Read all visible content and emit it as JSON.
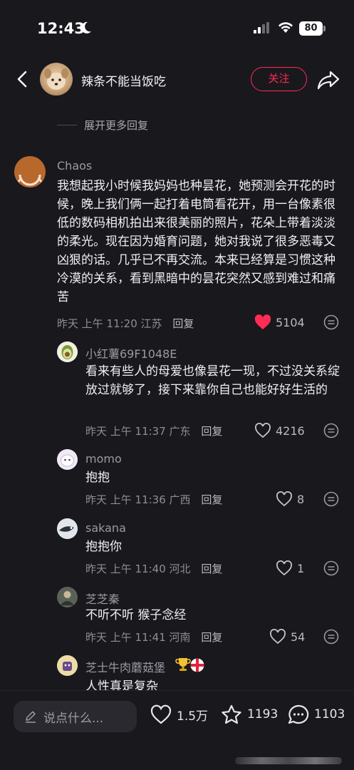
{
  "status": {
    "time": "12:43",
    "battery": "80"
  },
  "nav": {
    "title": "辣条不能当饭吃",
    "follow_label": "关注"
  },
  "thread": {
    "expand_label": "展开更多回复"
  },
  "main_comment": {
    "username": "Chaos",
    "text": "我想起我小时候我妈妈也种昙花，她预测会开花的时候，晚上我们俩一起打着电筒看花开，用一台像素很低的数码相机拍出来很美丽的照片，花朵上带着淡淡的柔光。现在因为婚育问题，她对我说了很多恶毒又凶狠的话。几乎已不再交流。本来已经算是习惯这种冷漠的关系，看到黑暗中的昙花突然又感到难过和痛苦",
    "time": "昨天 上午 11:20",
    "location": "江苏",
    "reply_label": "回复",
    "likes": "5104",
    "liked_color": "#fe2c55"
  },
  "replies": [
    {
      "username": "小红薯69F1048E",
      "text": "看来有些人的母爱也像昙花一现，不过没关系绽放过就够了，接下来靠你自己也能好好生活的",
      "time": "昨天 上午 11:37",
      "location": "广东",
      "reply_label": "回复",
      "likes": "4216"
    },
    {
      "username": "momo",
      "text": "抱抱",
      "time": "昨天 上午 11:36",
      "location": "广西",
      "reply_label": "回复",
      "likes": "8"
    },
    {
      "username": "sakana",
      "text": "抱抱你",
      "time": "昨天 上午 11:40",
      "location": "河北",
      "reply_label": "回复",
      "likes": "1"
    },
    {
      "username": "芝芝秦",
      "text": "不听不听 猴子念经",
      "time": "昨天 上午 11:41",
      "location": "河南",
      "reply_label": "回复",
      "likes": "54"
    },
    {
      "username": "芝士牛肉蘑菇堡",
      "text": "人性真是复杂"
    }
  ],
  "bottom": {
    "input_placeholder": "说点什么...",
    "like_count": "1.5万",
    "favorite_count": "1193",
    "comment_count": "1103"
  }
}
